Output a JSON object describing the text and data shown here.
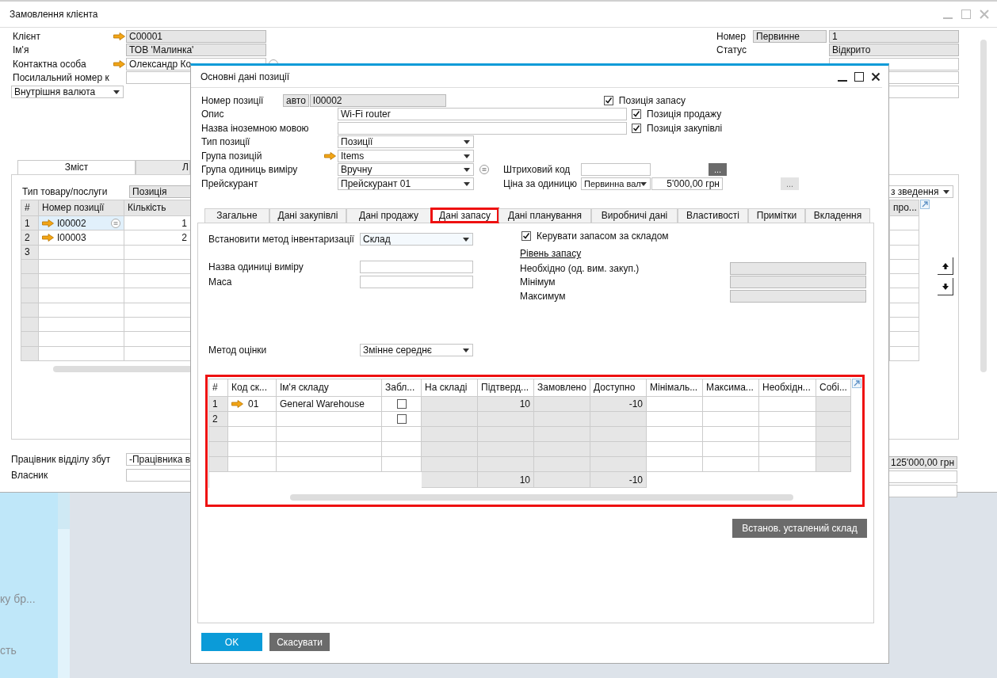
{
  "main_window": {
    "title": "Замовлення клієнта",
    "header_left": [
      {
        "label": "Клієнт",
        "arrow": true,
        "value": "C00001",
        "readonly": true
      },
      {
        "label": "Ім'я",
        "arrow": false,
        "value": "ТОВ 'Малинка'",
        "readonly": true
      },
      {
        "label": "Контактна особа",
        "arrow": true,
        "value": "Олександр Ко",
        "readonly": false
      },
      {
        "label": "Посилальний номер к",
        "arrow": false,
        "readonly": false
      }
    ],
    "currency": "Внутрішня валюта",
    "number": {
      "label": "Номер",
      "series": "Первинне",
      "value": "1"
    },
    "status": {
      "label": "Статус",
      "value": "Відкрито"
    },
    "tabs": [
      {
        "label": "Зміст",
        "selected": true
      },
      {
        "label": "Л",
        "selected": false
      }
    ],
    "item_type": {
      "label": "Тип товару/послуги",
      "value": "Позиція"
    },
    "summary": "з зведення",
    "lines": {
      "columns": [
        "#",
        "Номер позиції",
        "Кількість"
      ],
      "last_column": "про...",
      "rows": [
        {
          "number": "1",
          "arrow": true,
          "item": "I00002",
          "quantity": "1",
          "selected": true
        },
        {
          "number": "2",
          "arrow": true,
          "item": "I00003",
          "quantity": "2",
          "selected": false
        },
        {
          "number": "3",
          "arrow": false,
          "selected": false
        }
      ]
    },
    "sales_employee": {
      "label": "Працівник відділу збут",
      "value": "-Працівника в"
    },
    "owner": {
      "label": "Власник"
    },
    "total": "125'000,00 грн"
  },
  "desktop": {
    "texts": [
      "ку бр...",
      "сть"
    ]
  },
  "dialog": {
    "title": "Основні дані позиції",
    "item_number": {
      "label": "Номер позиції",
      "series": "авто",
      "value": "I00002"
    },
    "description": {
      "label": "Опис",
      "value": "Wi-Fi router"
    },
    "foreign_name": {
      "label": "Назва іноземною мовою"
    },
    "flags": [
      {
        "label": "Позиція запасу",
        "checked": true
      },
      {
        "label": "Позиція продажу",
        "checked": true
      },
      {
        "label": "Позиція закупівлі",
        "checked": true
      }
    ],
    "item_type": {
      "label": "Тип позиції",
      "value": "Позиції"
    },
    "item_group": {
      "label": "Група позицій",
      "value": "Items"
    },
    "uom_group": {
      "label": "Група одиниць виміру",
      "value": "Вручну"
    },
    "price_list": {
      "label": "Прейскурант",
      "value": "Прейскурант 01"
    },
    "barcode": {
      "label": "Штриховий код",
      "button": "..."
    },
    "unit_price": {
      "label": "Ціна за одиницю",
      "currency": "Первинна вал",
      "value": "5'000,00 грн",
      "button": "..."
    },
    "tabs": [
      {
        "label": "Загальне",
        "selected": false,
        "highlighted": false
      },
      {
        "label": "Дані закупівлі",
        "selected": false,
        "highlighted": false
      },
      {
        "label": "Дані продажу",
        "selected": false,
        "highlighted": false
      },
      {
        "label": "Дані запасу",
        "selected": true,
        "highlighted": true
      },
      {
        "label": "Дані планування",
        "selected": false,
        "highlighted": false
      },
      {
        "label": "Виробничі дані",
        "selected": false,
        "highlighted": false
      },
      {
        "label": "Властивості",
        "selected": false,
        "highlighted": false
      },
      {
        "label": "Примітки",
        "selected": false,
        "highlighted": false
      },
      {
        "label": "Вкладення",
        "selected": false,
        "highlighted": false
      }
    ],
    "inventory": {
      "method_label": "Встановити метод інвентаризації",
      "method": "Склад",
      "uom_name_label": "Назва одиниці виміру",
      "weight_label": "Маса",
      "valuation_label": "Метод оцінки",
      "valuation": "Змінне середнє",
      "manage_by_warehouse": {
        "label": "Керувати запасом за складом",
        "checked": true
      },
      "stock_level_label": "Рівень запасу",
      "levels": [
        "Необхідно (од. вим. закуп.)",
        "Мінімум",
        "Максимум"
      ]
    },
    "warehouses": {
      "highlighted": true,
      "columns": [
        {
          "label": "#",
          "readonly": true
        },
        {
          "label": "Код ск...",
          "readonly": false
        },
        {
          "label": "Ім'я складу",
          "readonly": false
        },
        {
          "label": "Забл...",
          "readonly": false
        },
        {
          "label": "На складі",
          "readonly": true
        },
        {
          "label": "Підтверд...",
          "readonly": true
        },
        {
          "label": "Замовлено",
          "readonly": true
        },
        {
          "label": "Доступно",
          "readonly": true
        },
        {
          "label": "Мінімаль...",
          "readonly": false
        },
        {
          "label": "Максима...",
          "readonly": false
        },
        {
          "label": "Необхідн...",
          "readonly": false
        },
        {
          "label": "Собі...",
          "readonly": true
        }
      ],
      "rows": [
        {
          "number": "1",
          "arrow": true,
          "code": "01",
          "name": "General Warehouse",
          "locked": false,
          "committed": "10",
          "available": "-10"
        },
        {
          "number": "2",
          "arrow": false,
          "locked": false
        }
      ],
      "totals": {
        "committed": "10",
        "available": "-10"
      }
    },
    "set_default": "Встанов. усталений склад",
    "buttons": [
      {
        "label": "OK",
        "kind": "primary"
      },
      {
        "label": "Скасувати",
        "kind": "secondary"
      }
    ]
  }
}
